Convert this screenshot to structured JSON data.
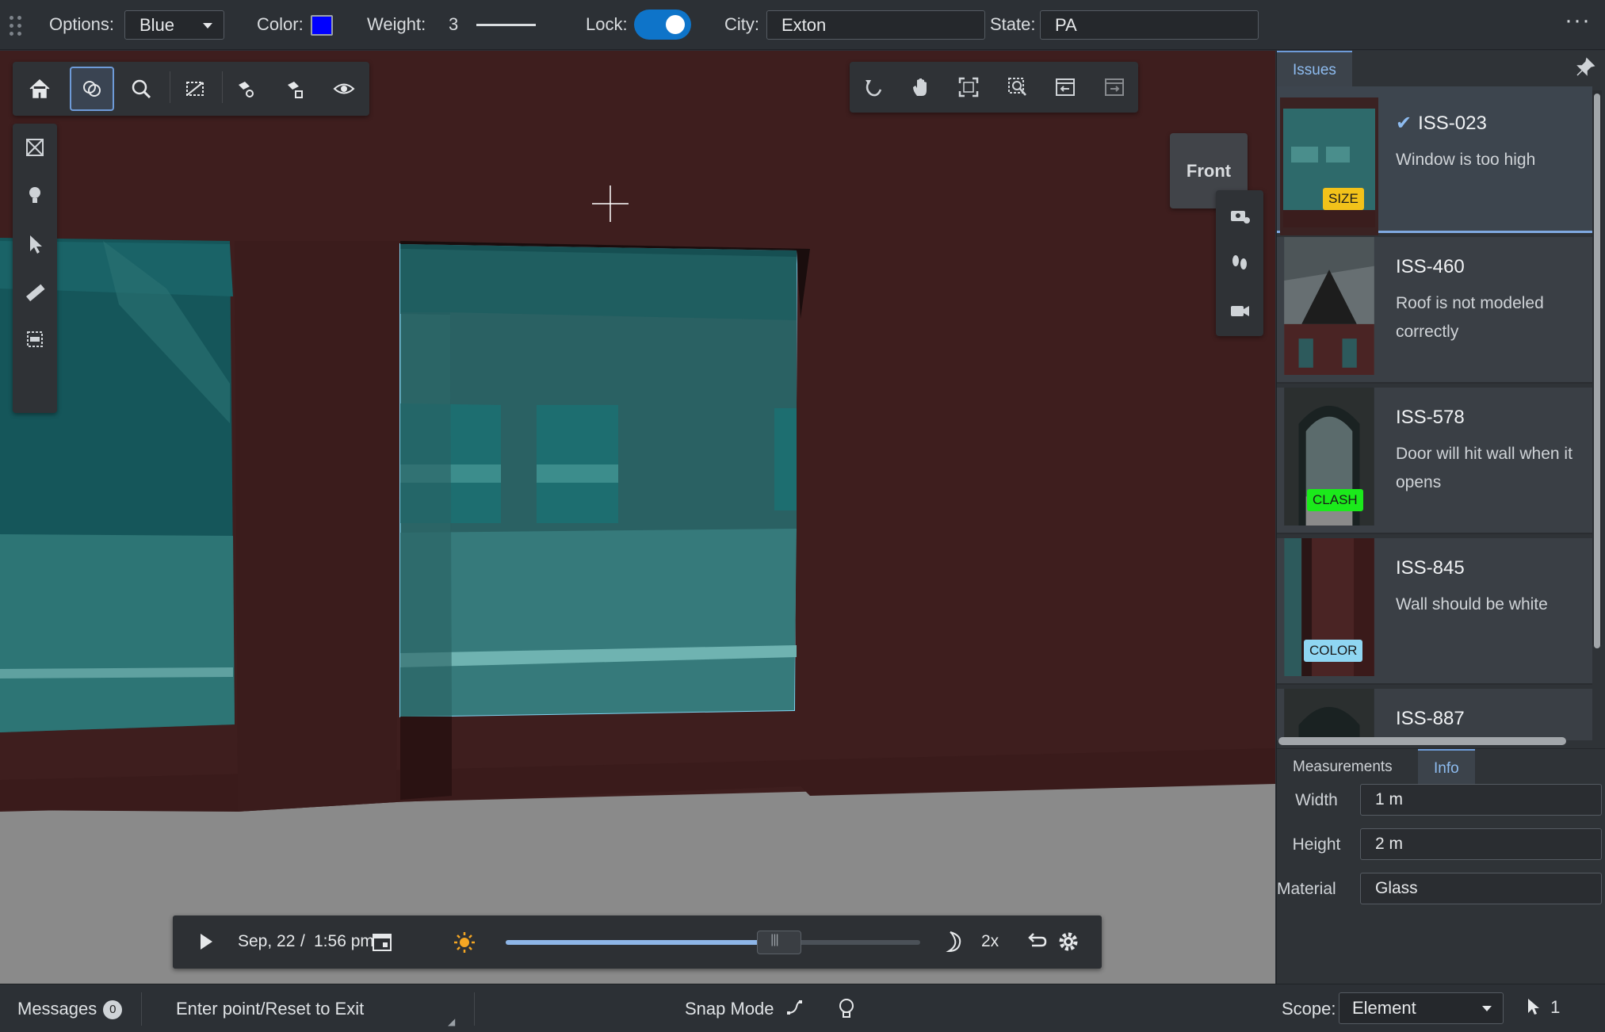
{
  "toolbar": {
    "options_label": "Options:",
    "options_value": "Blue",
    "color_label": "Color:",
    "color_value": "#0000ff",
    "weight_label": "Weight:",
    "weight_value": "3",
    "lock_label": "Lock:",
    "lock_on": true,
    "city_label": "City:",
    "city_value": "Exton",
    "state_label": "State:",
    "state_value": "PA",
    "more_icon": "more-horizontal-icon"
  },
  "viewport": {
    "left_tools": [
      "home-icon",
      "view-selector-icon",
      "search-icon",
      "section-icon",
      "hide-icon",
      "isolate-icon",
      "eye-icon"
    ],
    "right_tools": [
      "rotate-icon",
      "pan-icon",
      "fit-view-icon",
      "window-area-icon",
      "previous-view-icon",
      "next-view-icon"
    ],
    "side_tools": [
      "clip-icon",
      "lightbulb-icon",
      "select-icon",
      "measure-icon",
      "section-tools-icon"
    ],
    "right_side_tools": [
      "camera-location-icon",
      "walk-icon",
      "video-camera-icon"
    ],
    "view_cube_label": "Front",
    "timeline": {
      "date": "Sep, 22",
      "separator": "/",
      "time": "1:56 pm",
      "speed": "2x",
      "progress": 0.66
    }
  },
  "panel": {
    "tab_issues": "Issues",
    "issues": [
      {
        "id": "ISS-023",
        "desc": "Window is too high",
        "badge": "SIZE",
        "badge_color": "#f2c21a",
        "selected": true,
        "checked": true
      },
      {
        "id": "ISS-460",
        "desc": "Roof is not modeled correctly",
        "badge": "",
        "badge_color": "",
        "selected": false,
        "checked": false
      },
      {
        "id": "ISS-578",
        "desc": "Door will hit wall when it opens",
        "badge": "CLASH",
        "badge_color": "#1bea1b",
        "selected": false,
        "checked": false
      },
      {
        "id": "ISS-845",
        "desc": "Wall should be white",
        "badge": "COLOR",
        "badge_color": "#8fd6f2",
        "selected": false,
        "checked": false
      },
      {
        "id": "ISS-887",
        "desc": "",
        "badge": "",
        "badge_color": "",
        "selected": false,
        "checked": false
      }
    ],
    "tab_measurements": "Measurements",
    "tab_info": "Info",
    "properties": [
      {
        "label": "Width",
        "value": "1 m"
      },
      {
        "label": "Height",
        "value": "2 m"
      },
      {
        "label": "Material",
        "value": "Glass"
      }
    ]
  },
  "statusbar": {
    "messages_label": "Messages",
    "messages_count": "0",
    "prompt": "Enter point/Reset to Exit",
    "snap_mode": "Snap Mode",
    "scope_label": "Scope:",
    "scope_value": "Element",
    "selection_count": "1"
  }
}
